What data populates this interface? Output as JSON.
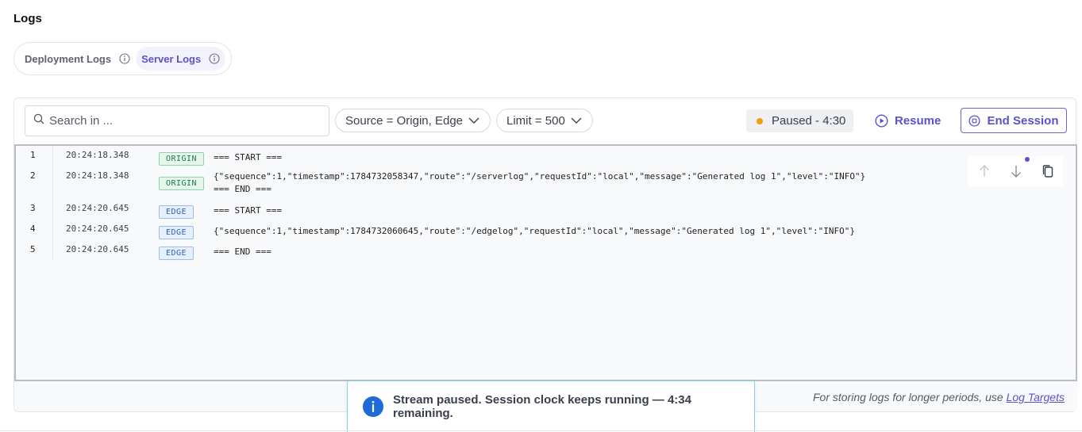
{
  "page": {
    "title": "Logs"
  },
  "tabs": [
    {
      "label": "Deployment Logs",
      "active": false,
      "icon": "info-icon"
    },
    {
      "label": "Server Logs",
      "active": true,
      "icon": "info-icon"
    }
  ],
  "filters": {
    "search_placeholder": "Search in ...",
    "source_label": "Source = Origin, Edge",
    "limit_label": "Limit = 500"
  },
  "session": {
    "status_text": "Paused - 4:30",
    "status_color": "#f59e0b",
    "resume_label": "Resume",
    "end_label": "End Session"
  },
  "logs": [
    {
      "num": "1",
      "ts": "20:24:18.348",
      "source": "ORIGIN",
      "message": "=== START ==="
    },
    {
      "num": "2",
      "ts": "20:24:18.348",
      "source": "ORIGIN",
      "message": "{\"sequence\":1,\"timestamp\":1784732058347,\"route\":\"/serverlog\",\"requestId\":\"local\",\"message\":\"Generated log 1\",\"level\":\"INFO\"}\n=== END ==="
    },
    {
      "num": "3",
      "ts": "20:24:20.645",
      "source": "EDGE",
      "message": "=== START ==="
    },
    {
      "num": "4",
      "ts": "20:24:20.645",
      "source": "EDGE",
      "message": "{\"sequence\":1,\"timestamp\":1784732060645,\"route\":\"/edgelog\",\"requestId\":\"local\",\"message\":\"Generated log 1\",\"level\":\"INFO\"}"
    },
    {
      "num": "5",
      "ts": "20:24:20.645",
      "source": "EDGE",
      "message": "=== END ==="
    }
  ],
  "footer": {
    "note_prefix": "For storing logs for longer periods, use ",
    "link_label": "Log Targets"
  },
  "toast": {
    "message": "Stream paused. Session clock keeps running — 4:34 remaining.",
    "icon": "info-icon"
  },
  "colors": {
    "accent": "#5b52c9",
    "origin_badge": "#1f7a45",
    "edge_badge": "#2f62b3",
    "toast_icon": "#1e6ad6"
  }
}
